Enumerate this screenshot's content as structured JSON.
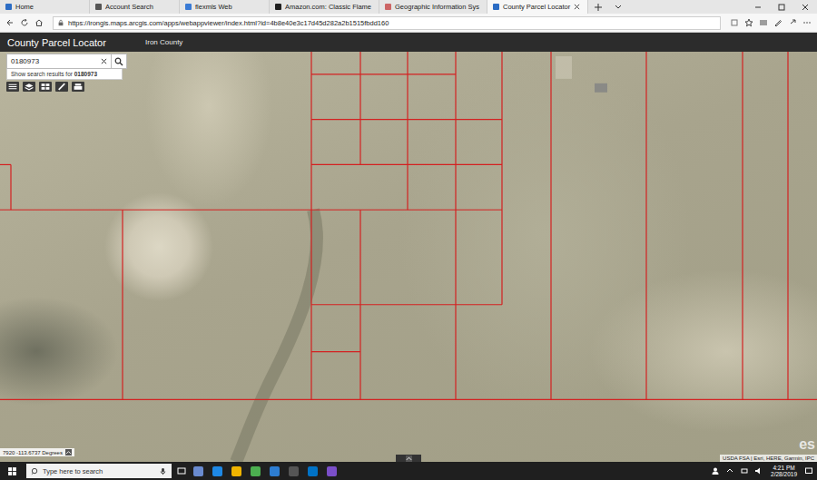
{
  "browser": {
    "tabs": [
      {
        "label": "Home",
        "selected": false
      },
      {
        "label": "Account Search",
        "selected": false
      },
      {
        "label": "flexmls Web",
        "selected": false
      },
      {
        "label": "Amazon.com: Classic Flame",
        "selected": false
      },
      {
        "label": "Geographic Information Sys",
        "selected": false
      },
      {
        "label": "County Parcel Locator",
        "selected": true
      }
    ],
    "url": "https://irongis.maps.arcgis.com/apps/webappviewer/index.html?id=4b8e40e3c17d45d282a2b1515fbdd160"
  },
  "app": {
    "title": "County Parcel Locator",
    "subtitle": "Iron County"
  },
  "search": {
    "value": "0180973",
    "suggestion_prefix": "Show search results for ",
    "suggestion_term": "0180973"
  },
  "map": {
    "coordinates": "7920 -113.6737 Degrees",
    "attribution": "USDA FSA | Esri, HERE, Garmin, IPC",
    "logo": "es"
  },
  "taskbar": {
    "search_placeholder": "Type here to search",
    "time": "4:21 PM",
    "date": "2/28/2019"
  }
}
